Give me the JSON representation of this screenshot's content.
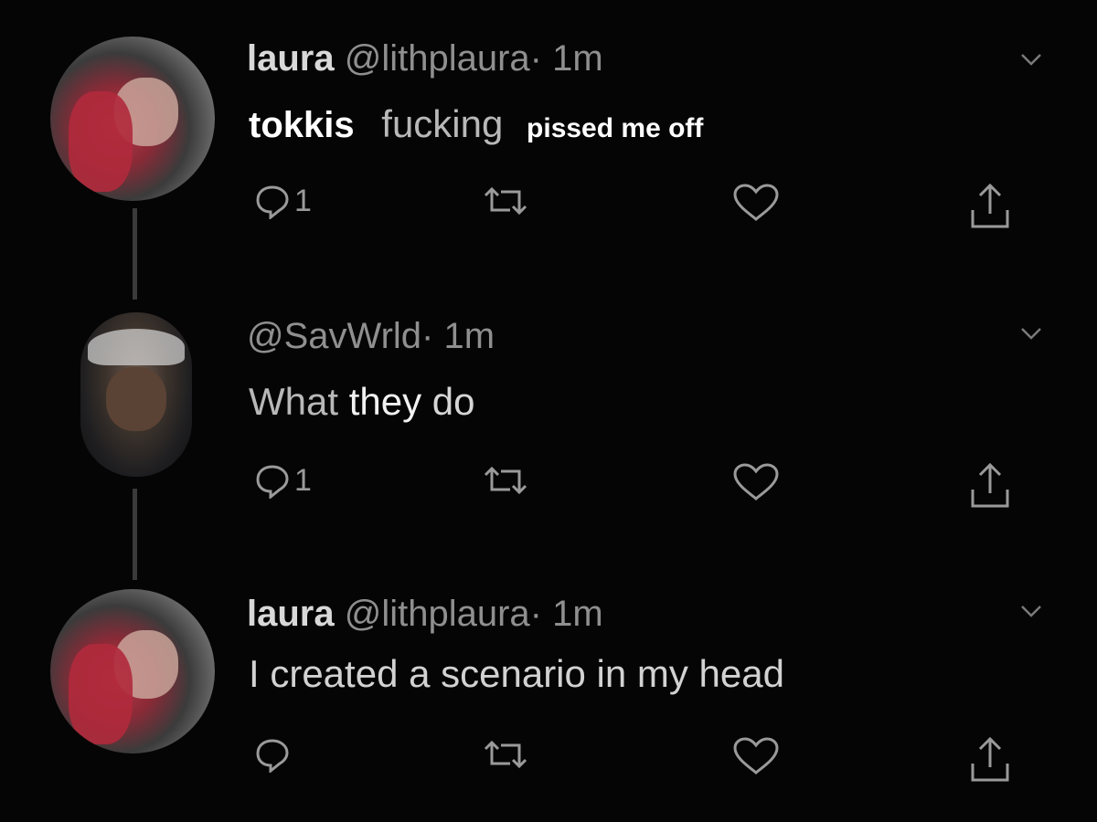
{
  "tweets": [
    {
      "avatar": "laura-avatar",
      "name": "laura",
      "handle": "@lithplaura",
      "dot": "·",
      "time": "1m",
      "text_parts": [
        "tokkis",
        "fucking",
        "pissed me off"
      ],
      "reply_count": "1",
      "has_more_menu": true
    },
    {
      "avatar": "savwrld-avatar",
      "name": "",
      "handle": "@SavWrld",
      "dot": "·",
      "time": "1m",
      "text_parts": [
        "What",
        "they",
        "do"
      ],
      "reply_count": "1",
      "has_more_menu": true
    },
    {
      "avatar": "laura-avatar",
      "name": "laura",
      "handle": "@lithplaura",
      "dot": "·",
      "time": "1m",
      "text_parts": [
        "I created a scenario in my head"
      ],
      "reply_count": "",
      "has_more_menu": true
    }
  ],
  "icons": {
    "reply": "reply-icon",
    "retweet": "retweet-icon",
    "like": "heart-icon",
    "share": "share-icon",
    "more": "chevron-down-icon"
  },
  "colors": {
    "background": "#050505",
    "name": "#d8d8d8",
    "meta": "#8f8f8f",
    "icon": "#9a9a9a",
    "emphasis": "#ffffff"
  }
}
